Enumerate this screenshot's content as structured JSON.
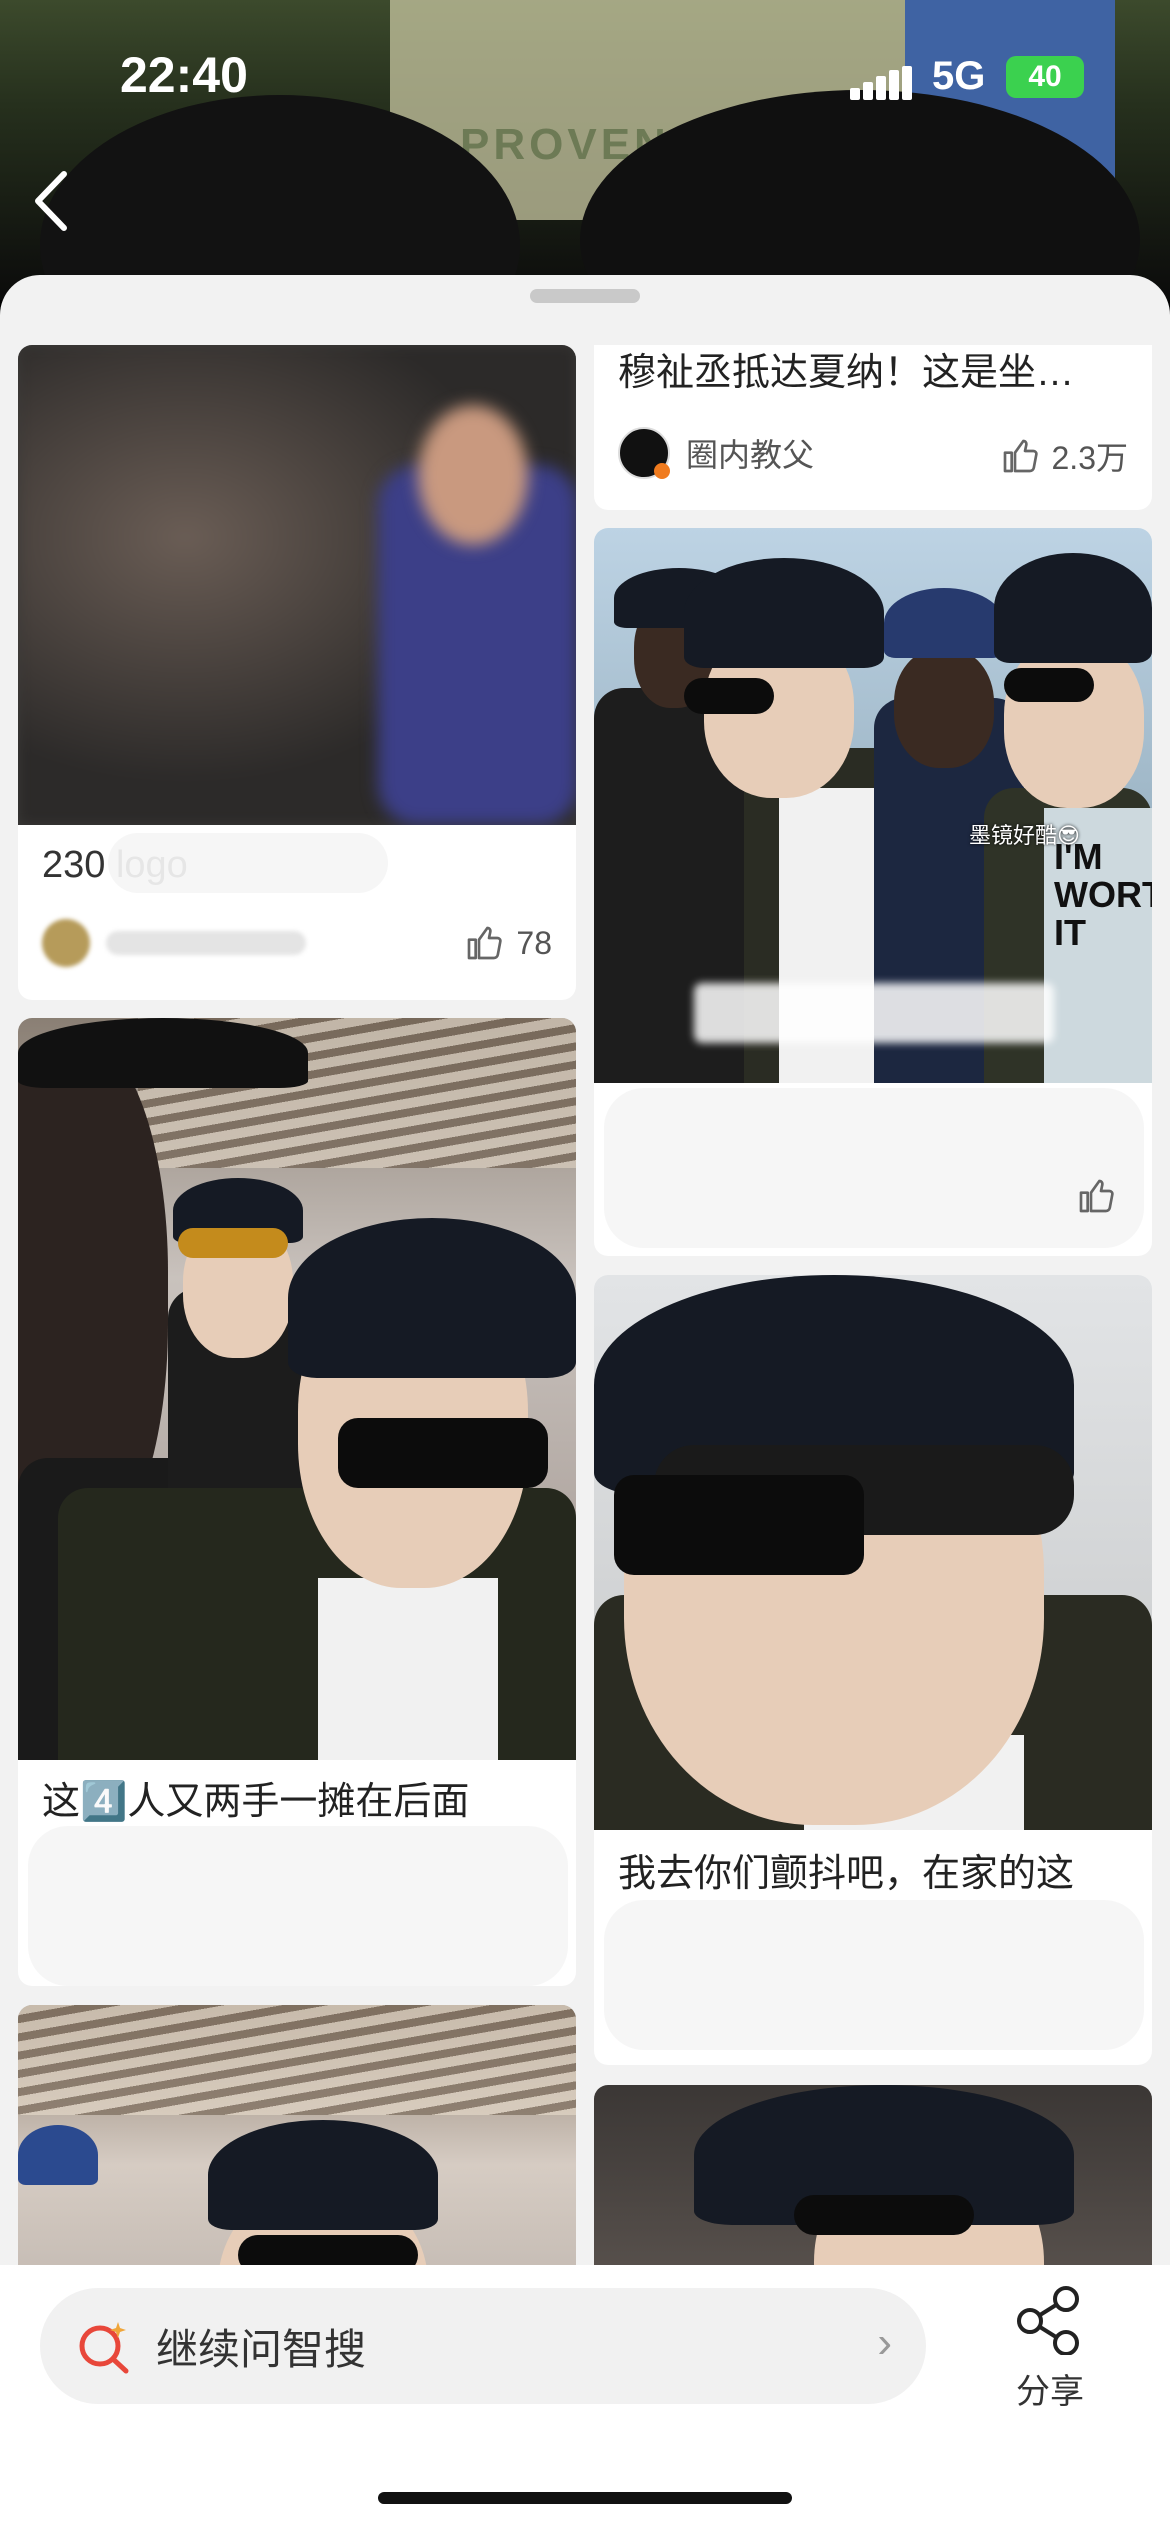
{
  "status_bar": {
    "time": "22:40",
    "network": "5G",
    "battery": "40"
  },
  "background_video": {
    "banner_text": "PROVENCE"
  },
  "feed": {
    "cards": [
      {
        "id": "card-left-1",
        "title": "230   logo",
        "author": "",
        "likes": "78"
      },
      {
        "id": "card-right-1",
        "title": "穆祉丞抵达夏纳！这是坐…",
        "author": "圈内教父",
        "likes": "2.3万"
      },
      {
        "id": "card-right-2",
        "title": "",
        "overlay_text": "墨镜好酷😎",
        "shirt_text": "I'M WORTH IT",
        "author": "",
        "likes": ""
      },
      {
        "id": "card-left-2",
        "title": "这4️⃣人又两手一摊在后面",
        "title_line2": "",
        "author": "",
        "likes": ""
      },
      {
        "id": "card-right-3",
        "title": "我去你们颤抖吧，在家的这",
        "author": "",
        "likes": ""
      }
    ]
  },
  "bottom_bar": {
    "ask_label": "继续问智搜",
    "share_label": "分享"
  },
  "colors": {
    "accent": "#e8473a",
    "battery": "#3bd14f",
    "sheet_bg": "#f2f2f2"
  }
}
